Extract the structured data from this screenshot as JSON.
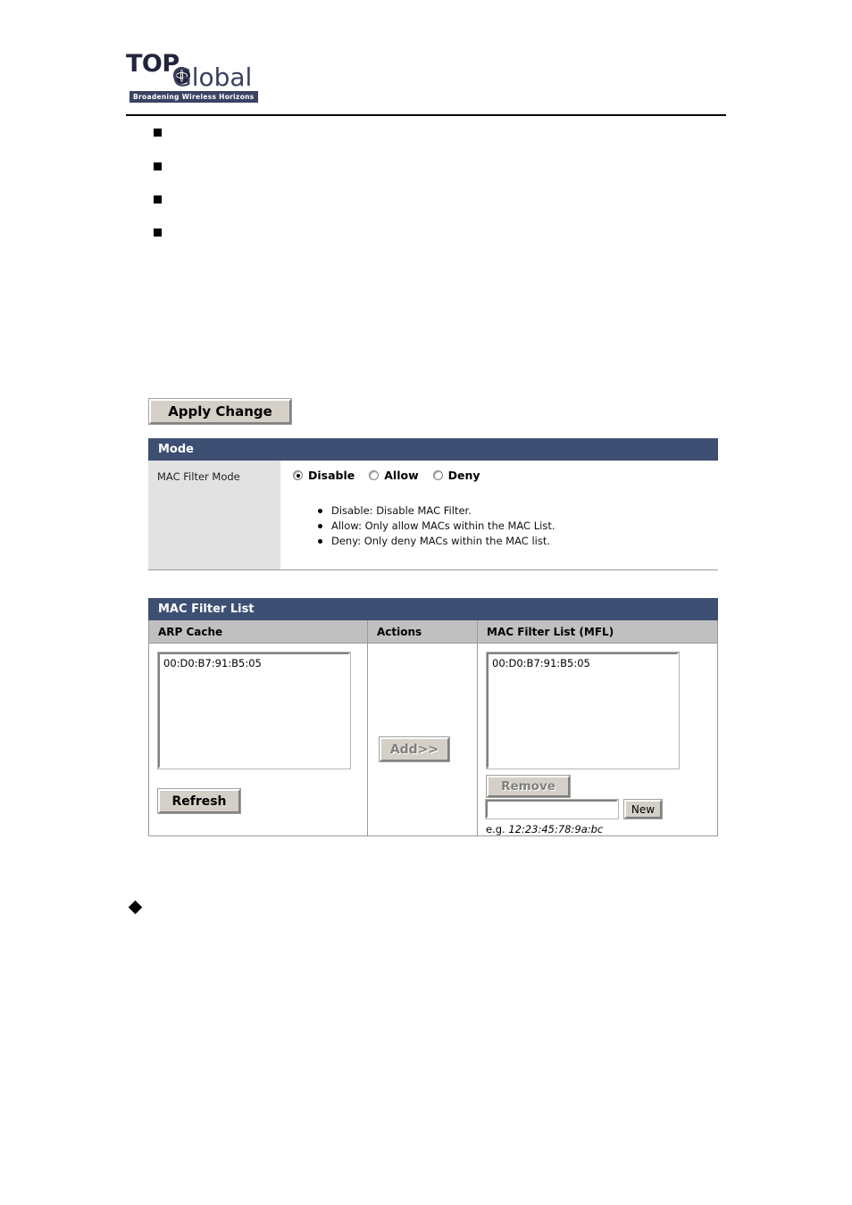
{
  "brand": {
    "logo_top": "TOP",
    "logo_bottom": "Global",
    "tagline": "Broadening Wireless Horizons",
    "globe_icon": "globe-icon"
  },
  "outline_bullets": [
    {
      "marker": "■",
      "text": ""
    },
    {
      "marker": "■",
      "text": ""
    },
    {
      "marker": "■",
      "text": ""
    },
    {
      "marker": "■",
      "text": ""
    }
  ],
  "bottom_bullet": {
    "marker": "◆",
    "text": ""
  },
  "toolbar": {
    "apply_label": "Apply Change"
  },
  "mode_panel": {
    "title": "Mode",
    "field_label": "MAC Filter Mode",
    "options": [
      {
        "label": "Disable",
        "selected": true
      },
      {
        "label": "Allow",
        "selected": false
      },
      {
        "label": "Deny",
        "selected": false
      }
    ],
    "notes": [
      "Disable: Disable MAC Filter.",
      "Allow: Only allow MACs within the MAC List.",
      "Deny: Only deny MACs within the MAC list."
    ]
  },
  "mfl_panel": {
    "title": "MAC Filter List",
    "columns": {
      "arp": "ARP Cache",
      "actions": "Actions",
      "mfl": "MAC Filter List (MFL)"
    },
    "arp_cache_entries": [
      "00:D0:B7:91:B5:05"
    ],
    "mfl_entries": [
      "00:D0:B7:91:B5:05"
    ],
    "refresh_label": "Refresh",
    "add_label": "Add>>",
    "remove_label": "Remove",
    "new_label": "New",
    "mac_input_value": "",
    "mac_input_placeholder": "",
    "example_prefix": "e.g.",
    "example_value": "12:23:45:78:9a:bc"
  },
  "colors": {
    "panel_header": "#3e4f74",
    "column_header": "#c0c0c0",
    "label_column": "#e2e2e2",
    "button_face": "#d4d0c8",
    "disabled_text": "#808080"
  }
}
